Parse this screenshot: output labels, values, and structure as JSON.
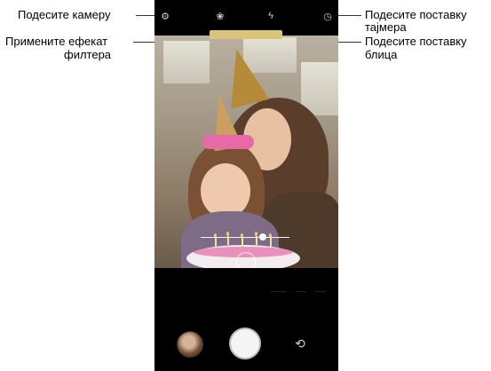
{
  "annotations": {
    "camera_settings": "Подесите камеру",
    "filter_effect_line1": "Примените ефекат",
    "filter_effect_line2": "филтера",
    "timer_line1": "Подесите поставку",
    "timer_line2": "тајмера",
    "flash_line1": "Подесите поставку",
    "flash_line2": "блица"
  },
  "topbar": {
    "icons": [
      "gear-icon",
      "filter-icon",
      "flash-icon",
      "timer-icon"
    ]
  },
  "controls": {
    "icons": [
      "gallery-thumbnail",
      "shutter-button",
      "switch-camera-icon"
    ]
  },
  "colors": {
    "phone_background": "#000000",
    "banner": "#d8c47a",
    "slider": "#ffffff"
  }
}
